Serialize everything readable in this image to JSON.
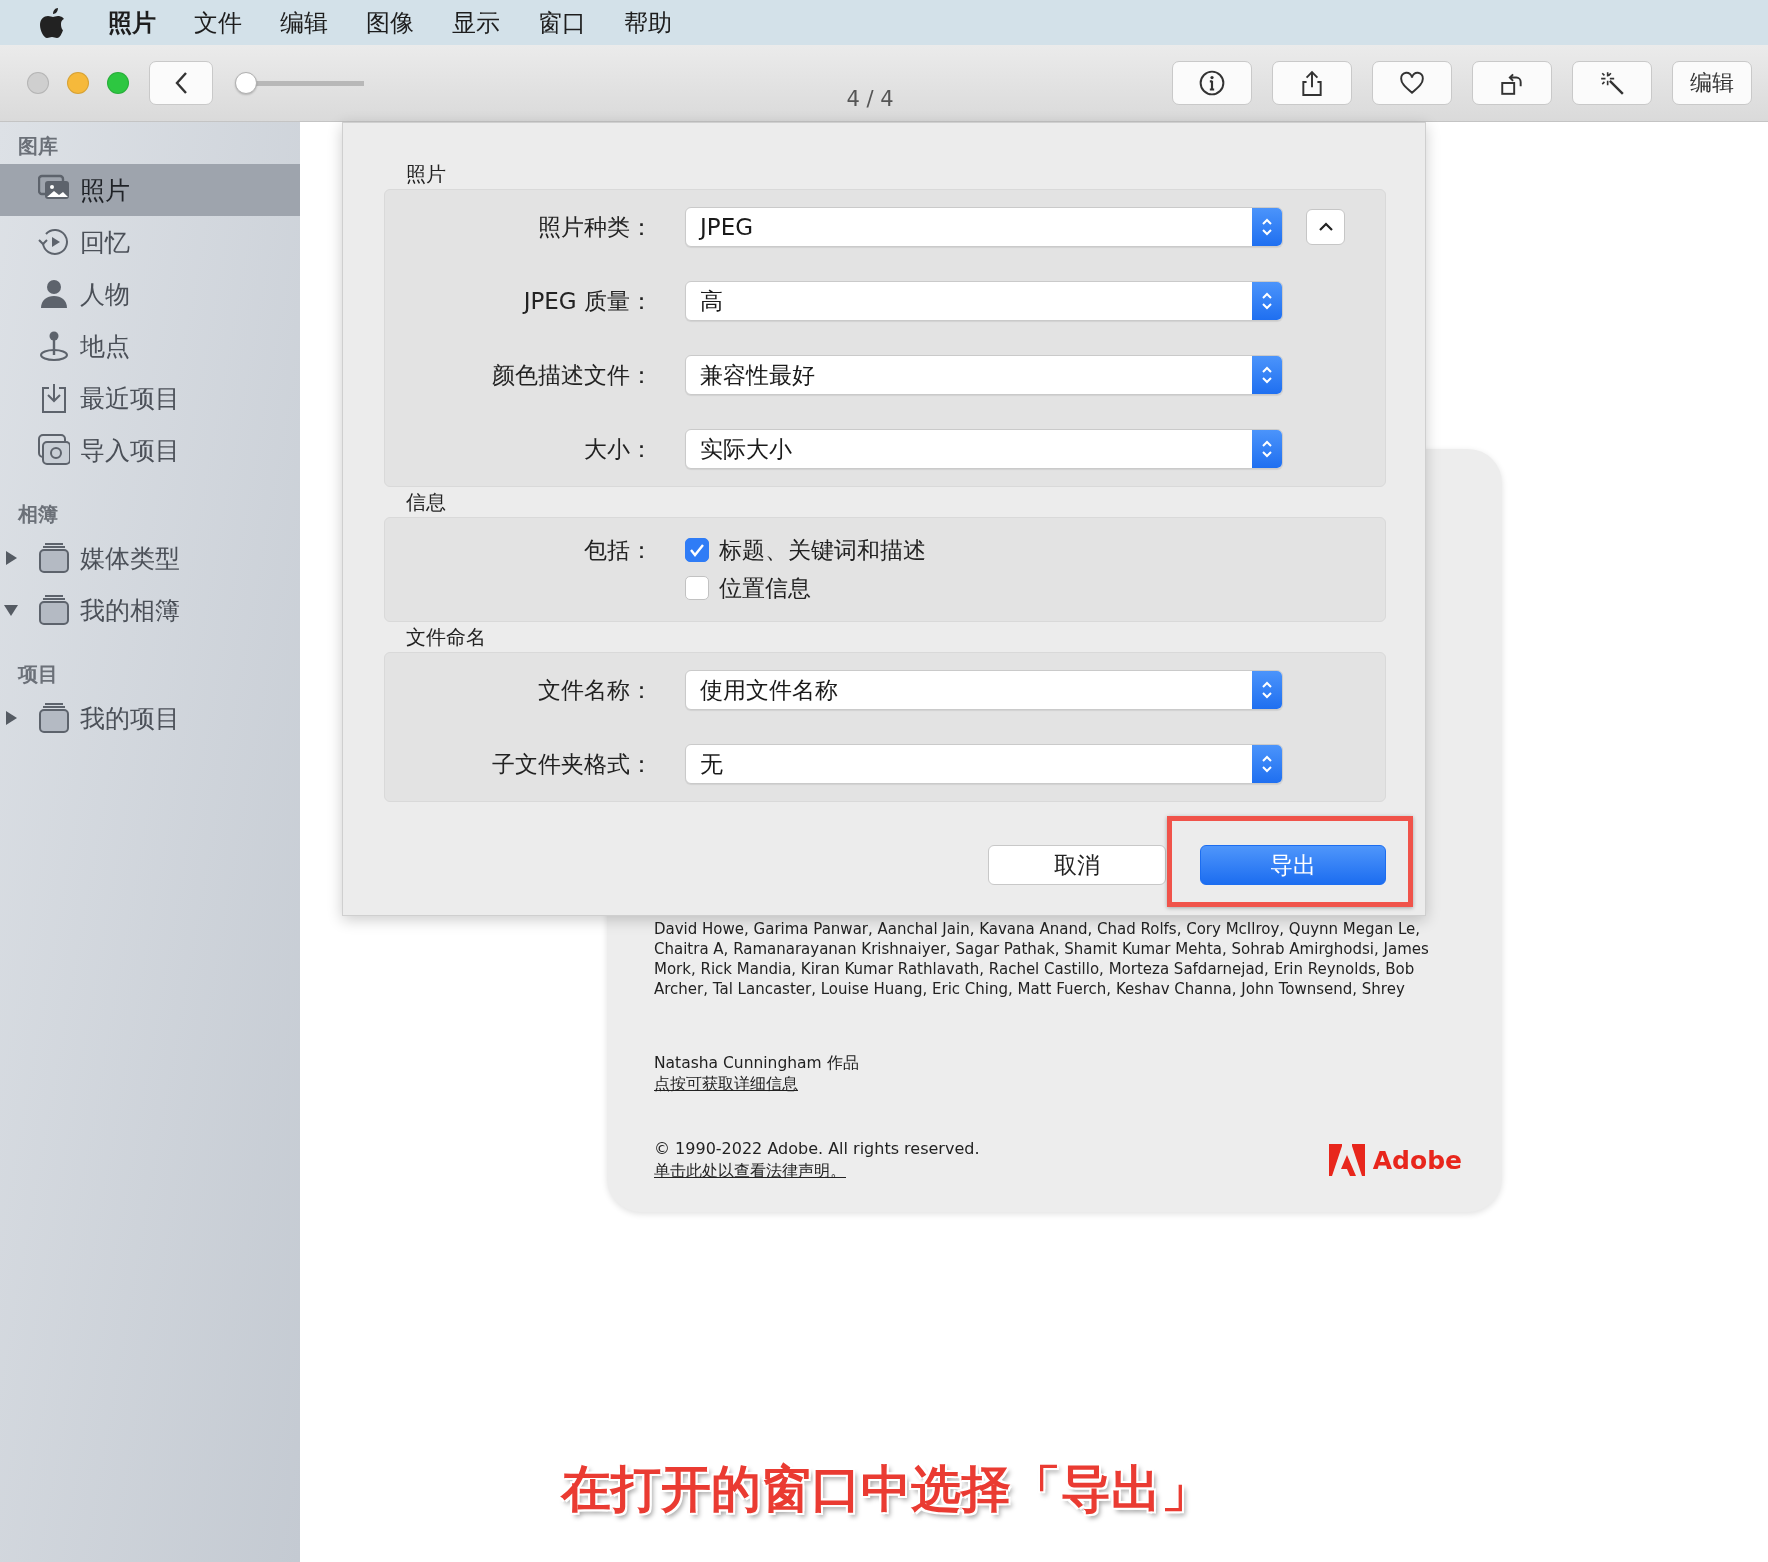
{
  "menu_bar": {
    "items": [
      "照片",
      "文件",
      "编辑",
      "图像",
      "显示",
      "窗口",
      "帮助"
    ]
  },
  "toolbar": {
    "slider": {
      "level": 0
    },
    "counter": "4 / 4",
    "buttons": [
      {
        "kind": "info"
      },
      {
        "kind": "share"
      },
      {
        "kind": "heart"
      },
      {
        "kind": "rotate"
      },
      {
        "kind": "magic"
      },
      {
        "kind": "text",
        "label": "编辑"
      }
    ]
  },
  "sidebar": {
    "sections": [
      {
        "title": "图库",
        "items": [
          {
            "kind": "photos",
            "label": "照片",
            "selected": true
          },
          {
            "kind": "memories",
            "label": "回忆",
            "selected": false
          },
          {
            "kind": "people",
            "label": "人物",
            "selected": false
          },
          {
            "kind": "places",
            "label": "地点",
            "selected": false
          },
          {
            "kind": "recent",
            "label": "最近项目",
            "selected": false
          },
          {
            "kind": "imports",
            "label": "导入项目",
            "selected": false
          }
        ]
      },
      {
        "title": "相簿",
        "items": [
          {
            "kind": "album",
            "label": "媒体类型",
            "selected": false,
            "expanded": false
          },
          {
            "kind": "album",
            "label": "我的相簿",
            "selected": false,
            "expanded": true
          }
        ]
      },
      {
        "title": "项目",
        "items": [
          {
            "kind": "album",
            "label": "我的项目",
            "selected": false,
            "expanded": false
          }
        ]
      }
    ]
  },
  "about_card": {
    "credits": "David Howe, Garima Panwar, Aanchal Jain, Kavana Anand, Chad Rolfs, Cory McIlroy, Quynn Megan Le, Chaitra A, Ramanarayanan Krishnaiyer, Sagar Pathak, Shamit Kumar Mehta, Sohrab Amirghodsi, James Mork, Rick Mandia, Kiran Kumar Rathlavath, Rachel Castillo, Morteza Safdarnejad, Erin Reynolds, Bob Archer, Tal Lancaster, Louise Huang, Eric Ching, Matt Fuerch, Keshav Channa, John Townsend, Shrey",
    "author": "Natasha Cunningham 作品",
    "details_link": "点按可获取详细信息",
    "copyright": "© 1990-2022 Adobe. All rights reserved.",
    "legal_link": "单击此处以查看法律声明。",
    "brand": "Adobe"
  },
  "export_dialog": {
    "sections": [
      {
        "title": "照片",
        "rows": [
          {
            "kind": "popup",
            "label": "照片种类：",
            "value": "JPEG"
          },
          {
            "kind": "popup",
            "label": "JPEG 质量：",
            "value": "高"
          },
          {
            "kind": "popup",
            "label": "颜色描述文件：",
            "value": "兼容性最好"
          },
          {
            "kind": "popup",
            "label": "大小：",
            "value": "实际大小"
          }
        ]
      },
      {
        "title": "信息",
        "rows": [
          {
            "kind": "checks",
            "label": "包括：",
            "options": [
              {
                "label": "标题、关键词和描述",
                "checked": true
              },
              {
                "label": "位置信息",
                "checked": false
              }
            ]
          }
        ]
      },
      {
        "title": "文件命名",
        "rows": [
          {
            "kind": "popup",
            "label": "文件名称：",
            "value": "使用文件名称"
          },
          {
            "kind": "popup",
            "label": "子文件夹格式：",
            "value": "无"
          }
        ]
      }
    ],
    "buttons": [
      {
        "kind": "default",
        "label": "取消",
        "highlighted": false
      },
      {
        "kind": "primary",
        "label": "导出",
        "highlighted": true
      }
    ]
  },
  "caption": "在打开的窗口中选择「导出」"
}
